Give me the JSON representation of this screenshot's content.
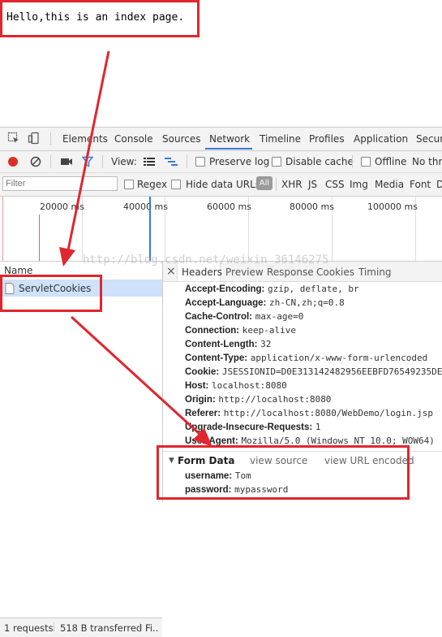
{
  "page": {
    "text": "Hello,this is an index page."
  },
  "devtools": {
    "tabs": [
      "Elements",
      "Console",
      "Sources",
      "Network",
      "Timeline",
      "Profiles",
      "Application",
      "Securi"
    ],
    "active_tab": "Network",
    "toolbar": {
      "view_label": "View:",
      "preserve_log": "Preserve log",
      "disable_cache": "Disable cache",
      "offline": "Offline",
      "throttle": "No thro"
    },
    "filterbar": {
      "placeholder": "Filter",
      "regex": "Regex",
      "hide_data_urls": "Hide data URLs",
      "types": [
        "All",
        "XHR",
        "JS",
        "CSS",
        "Img",
        "Media",
        "Font",
        "D"
      ]
    },
    "timeline_ticks": [
      "20000 ms",
      "40000 ms",
      "60000 ms",
      "80000 ms",
      "100000 ms"
    ],
    "requests": {
      "column_name": "Name",
      "items": [
        "ServletCookies"
      ]
    },
    "detail_tabs": [
      "Headers",
      "Preview",
      "Response",
      "Cookies",
      "Timing"
    ],
    "active_detail_tab": "Headers",
    "headers": [
      {
        "key": "Accept-Encoding:",
        "value": "gzip, deflate, br"
      },
      {
        "key": "Accept-Language:",
        "value": "zh-CN,zh;q=0.8"
      },
      {
        "key": "Cache-Control:",
        "value": "max-age=0"
      },
      {
        "key": "Connection:",
        "value": "keep-alive"
      },
      {
        "key": "Content-Length:",
        "value": "32"
      },
      {
        "key": "Content-Type:",
        "value": "application/x-www-form-urlencoded"
      },
      {
        "key": "Cookie:",
        "value": "JSESSIONID=D0E313142482956EEBFD76549235DE"
      },
      {
        "key": "Host:",
        "value": "localhost:8080"
      },
      {
        "key": "Origin:",
        "value": "http://localhost:8080"
      },
      {
        "key": "Referer:",
        "value": "http://localhost:8080/WebDemo/login.jsp"
      },
      {
        "key": "Upgrade-Insecure-Requests:",
        "value": "1"
      },
      {
        "key": "User-Agent:",
        "value": "Mozilla/5.0 (Windows NT 10.0; WOW64)"
      }
    ],
    "form_data": {
      "title": "Form Data",
      "view_source": "view source",
      "view_url_encoded": "view URL encoded",
      "fields": [
        {
          "key": "username:",
          "value": "Tom"
        },
        {
          "key": "password:",
          "value": "mypassword"
        }
      ]
    },
    "status": {
      "requests": "1 requests",
      "transferred": "518 B transferred",
      "finish": "Fi.."
    },
    "close_glyph": "×"
  },
  "watermark": "http://blog.csdn.net/weixin_36146275",
  "colors": {
    "annotation": "#e0262e",
    "accent": "#3879d9",
    "record": "#d93025"
  }
}
